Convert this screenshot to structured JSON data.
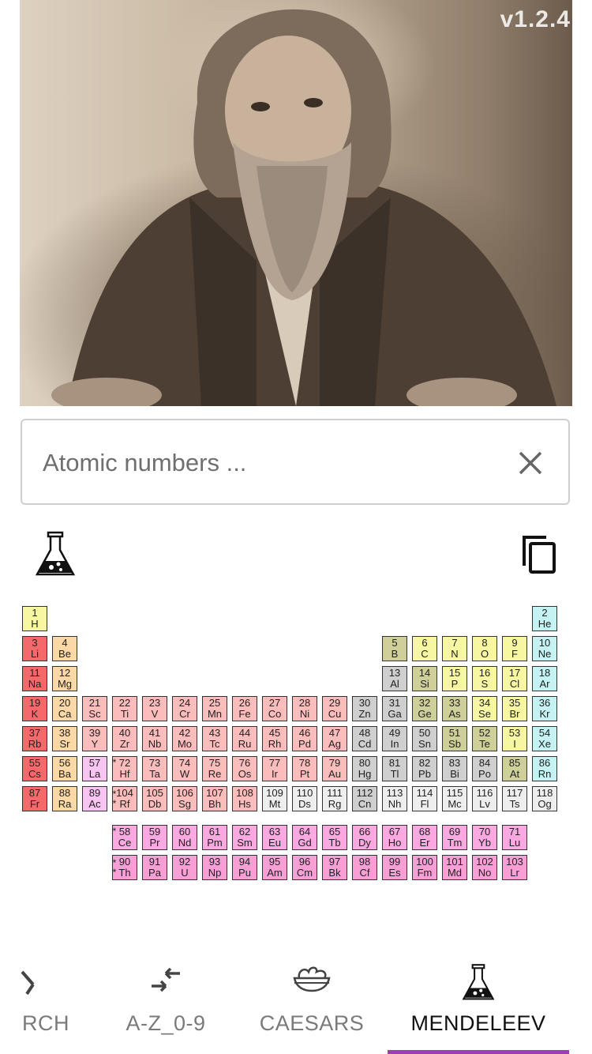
{
  "version": "v1.2.4",
  "search": {
    "placeholder": "Atomic numbers ..."
  },
  "toolbar": {
    "flask_icon": "flask-icon",
    "copy_icon": "copy-icon"
  },
  "colors": {
    "nonmetal": "#f7f7a3",
    "noble": "#c5f3f3",
    "alkali": "#f46a6a",
    "alkaline": "#fbd8a5",
    "metalloid": "#cfcf9a",
    "transition": "#fbbcbc",
    "posttransition": "#cfcfcf",
    "unknown": "#eeeeee",
    "lanthanide": "#fba9e0",
    "actinide": "#f99fd6",
    "scandium": "#f8c4f2",
    "accent": "#9b3fb5"
  },
  "elements": [
    {
      "n": "1",
      "s": "H",
      "r": 0,
      "c": 0,
      "cat": "nonmetal"
    },
    {
      "n": "2",
      "s": "He",
      "r": 0,
      "c": 17,
      "cat": "noble"
    },
    {
      "n": "3",
      "s": "Li",
      "r": 1,
      "c": 0,
      "cat": "alkali"
    },
    {
      "n": "4",
      "s": "Be",
      "r": 1,
      "c": 1,
      "cat": "alkaline"
    },
    {
      "n": "5",
      "s": "B",
      "r": 1,
      "c": 12,
      "cat": "metalloid"
    },
    {
      "n": "6",
      "s": "C",
      "r": 1,
      "c": 13,
      "cat": "nonmetal"
    },
    {
      "n": "7",
      "s": "N",
      "r": 1,
      "c": 14,
      "cat": "nonmetal"
    },
    {
      "n": "8",
      "s": "O",
      "r": 1,
      "c": 15,
      "cat": "nonmetal"
    },
    {
      "n": "9",
      "s": "F",
      "r": 1,
      "c": 16,
      "cat": "nonmetal"
    },
    {
      "n": "10",
      "s": "Ne",
      "r": 1,
      "c": 17,
      "cat": "noble"
    },
    {
      "n": "11",
      "s": "Na",
      "r": 2,
      "c": 0,
      "cat": "alkali"
    },
    {
      "n": "12",
      "s": "Mg",
      "r": 2,
      "c": 1,
      "cat": "alkaline"
    },
    {
      "n": "13",
      "s": "Al",
      "r": 2,
      "c": 12,
      "cat": "posttransition"
    },
    {
      "n": "14",
      "s": "Si",
      "r": 2,
      "c": 13,
      "cat": "metalloid"
    },
    {
      "n": "15",
      "s": "P",
      "r": 2,
      "c": 14,
      "cat": "nonmetal"
    },
    {
      "n": "16",
      "s": "S",
      "r": 2,
      "c": 15,
      "cat": "nonmetal"
    },
    {
      "n": "17",
      "s": "Cl",
      "r": 2,
      "c": 16,
      "cat": "nonmetal"
    },
    {
      "n": "18",
      "s": "Ar",
      "r": 2,
      "c": 17,
      "cat": "noble"
    },
    {
      "n": "19",
      "s": "K",
      "r": 3,
      "c": 0,
      "cat": "alkali"
    },
    {
      "n": "20",
      "s": "Ca",
      "r": 3,
      "c": 1,
      "cat": "alkaline"
    },
    {
      "n": "21",
      "s": "Sc",
      "r": 3,
      "c": 2,
      "cat": "transition"
    },
    {
      "n": "22",
      "s": "Ti",
      "r": 3,
      "c": 3,
      "cat": "transition"
    },
    {
      "n": "23",
      "s": "V",
      "r": 3,
      "c": 4,
      "cat": "transition"
    },
    {
      "n": "24",
      "s": "Cr",
      "r": 3,
      "c": 5,
      "cat": "transition"
    },
    {
      "n": "25",
      "s": "Mn",
      "r": 3,
      "c": 6,
      "cat": "transition"
    },
    {
      "n": "26",
      "s": "Fe",
      "r": 3,
      "c": 7,
      "cat": "transition"
    },
    {
      "n": "27",
      "s": "Co",
      "r": 3,
      "c": 8,
      "cat": "transition"
    },
    {
      "n": "28",
      "s": "Ni",
      "r": 3,
      "c": 9,
      "cat": "transition"
    },
    {
      "n": "29",
      "s": "Cu",
      "r": 3,
      "c": 10,
      "cat": "transition"
    },
    {
      "n": "30",
      "s": "Zn",
      "r": 3,
      "c": 11,
      "cat": "posttransition"
    },
    {
      "n": "31",
      "s": "Ga",
      "r": 3,
      "c": 12,
      "cat": "posttransition"
    },
    {
      "n": "32",
      "s": "Ge",
      "r": 3,
      "c": 13,
      "cat": "metalloid"
    },
    {
      "n": "33",
      "s": "As",
      "r": 3,
      "c": 14,
      "cat": "metalloid"
    },
    {
      "n": "34",
      "s": "Se",
      "r": 3,
      "c": 15,
      "cat": "nonmetal"
    },
    {
      "n": "35",
      "s": "Br",
      "r": 3,
      "c": 16,
      "cat": "nonmetal"
    },
    {
      "n": "36",
      "s": "Kr",
      "r": 3,
      "c": 17,
      "cat": "noble"
    },
    {
      "n": "37",
      "s": "Rb",
      "r": 4,
      "c": 0,
      "cat": "alkali"
    },
    {
      "n": "38",
      "s": "Sr",
      "r": 4,
      "c": 1,
      "cat": "alkaline"
    },
    {
      "n": "39",
      "s": "Y",
      "r": 4,
      "c": 2,
      "cat": "transition"
    },
    {
      "n": "40",
      "s": "Zr",
      "r": 4,
      "c": 3,
      "cat": "transition"
    },
    {
      "n": "41",
      "s": "Nb",
      "r": 4,
      "c": 4,
      "cat": "transition"
    },
    {
      "n": "42",
      "s": "Mo",
      "r": 4,
      "c": 5,
      "cat": "transition"
    },
    {
      "n": "43",
      "s": "Tc",
      "r": 4,
      "c": 6,
      "cat": "transition"
    },
    {
      "n": "44",
      "s": "Ru",
      "r": 4,
      "c": 7,
      "cat": "transition"
    },
    {
      "n": "45",
      "s": "Rh",
      "r": 4,
      "c": 8,
      "cat": "transition"
    },
    {
      "n": "46",
      "s": "Pd",
      "r": 4,
      "c": 9,
      "cat": "transition"
    },
    {
      "n": "47",
      "s": "Ag",
      "r": 4,
      "c": 10,
      "cat": "transition"
    },
    {
      "n": "48",
      "s": "Cd",
      "r": 4,
      "c": 11,
      "cat": "posttransition"
    },
    {
      "n": "49",
      "s": "In",
      "r": 4,
      "c": 12,
      "cat": "posttransition"
    },
    {
      "n": "50",
      "s": "Sn",
      "r": 4,
      "c": 13,
      "cat": "posttransition"
    },
    {
      "n": "51",
      "s": "Sb",
      "r": 4,
      "c": 14,
      "cat": "metalloid"
    },
    {
      "n": "52",
      "s": "Te",
      "r": 4,
      "c": 15,
      "cat": "metalloid"
    },
    {
      "n": "53",
      "s": "I",
      "r": 4,
      "c": 16,
      "cat": "nonmetal"
    },
    {
      "n": "54",
      "s": "Xe",
      "r": 4,
      "c": 17,
      "cat": "noble"
    },
    {
      "n": "55",
      "s": "Cs",
      "r": 5,
      "c": 0,
      "cat": "alkali"
    },
    {
      "n": "56",
      "s": "Ba",
      "r": 5,
      "c": 1,
      "cat": "alkaline"
    },
    {
      "n": "57",
      "s": "La",
      "r": 5,
      "c": 2,
      "cat": "scandium"
    },
    {
      "n": "72",
      "s": "Hf",
      "r": 5,
      "c": 3,
      "cat": "transition"
    },
    {
      "n": "73",
      "s": "Ta",
      "r": 5,
      "c": 4,
      "cat": "transition"
    },
    {
      "n": "74",
      "s": "W",
      "r": 5,
      "c": 5,
      "cat": "transition"
    },
    {
      "n": "75",
      "s": "Re",
      "r": 5,
      "c": 6,
      "cat": "transition"
    },
    {
      "n": "76",
      "s": "Os",
      "r": 5,
      "c": 7,
      "cat": "transition"
    },
    {
      "n": "77",
      "s": "Ir",
      "r": 5,
      "c": 8,
      "cat": "transition"
    },
    {
      "n": "78",
      "s": "Pt",
      "r": 5,
      "c": 9,
      "cat": "transition"
    },
    {
      "n": "79",
      "s": "Au",
      "r": 5,
      "c": 10,
      "cat": "transition"
    },
    {
      "n": "80",
      "s": "Hg",
      "r": 5,
      "c": 11,
      "cat": "posttransition"
    },
    {
      "n": "81",
      "s": "Tl",
      "r": 5,
      "c": 12,
      "cat": "posttransition"
    },
    {
      "n": "82",
      "s": "Pb",
      "r": 5,
      "c": 13,
      "cat": "posttransition"
    },
    {
      "n": "83",
      "s": "Bi",
      "r": 5,
      "c": 14,
      "cat": "posttransition"
    },
    {
      "n": "84",
      "s": "Po",
      "r": 5,
      "c": 15,
      "cat": "posttransition"
    },
    {
      "n": "85",
      "s": "At",
      "r": 5,
      "c": 16,
      "cat": "metalloid"
    },
    {
      "n": "86",
      "s": "Rn",
      "r": 5,
      "c": 17,
      "cat": "noble"
    },
    {
      "n": "87",
      "s": "Fr",
      "r": 6,
      "c": 0,
      "cat": "alkali"
    },
    {
      "n": "88",
      "s": "Ra",
      "r": 6,
      "c": 1,
      "cat": "alkaline"
    },
    {
      "n": "89",
      "s": "Ac",
      "r": 6,
      "c": 2,
      "cat": "scandium"
    },
    {
      "n": "104",
      "s": "Rf",
      "r": 6,
      "c": 3,
      "cat": "transition"
    },
    {
      "n": "105",
      "s": "Db",
      "r": 6,
      "c": 4,
      "cat": "transition"
    },
    {
      "n": "106",
      "s": "Sg",
      "r": 6,
      "c": 5,
      "cat": "transition"
    },
    {
      "n": "107",
      "s": "Bh",
      "r": 6,
      "c": 6,
      "cat": "transition"
    },
    {
      "n": "108",
      "s": "Hs",
      "r": 6,
      "c": 7,
      "cat": "transition"
    },
    {
      "n": "109",
      "s": "Mt",
      "r": 6,
      "c": 8,
      "cat": "unknown"
    },
    {
      "n": "110",
      "s": "Ds",
      "r": 6,
      "c": 9,
      "cat": "unknown"
    },
    {
      "n": "111",
      "s": "Rg",
      "r": 6,
      "c": 10,
      "cat": "unknown"
    },
    {
      "n": "112",
      "s": "Cn",
      "r": 6,
      "c": 11,
      "cat": "posttransition"
    },
    {
      "n": "113",
      "s": "Nh",
      "r": 6,
      "c": 12,
      "cat": "unknown"
    },
    {
      "n": "114",
      "s": "Fl",
      "r": 6,
      "c": 13,
      "cat": "unknown"
    },
    {
      "n": "115",
      "s": "Mc",
      "r": 6,
      "c": 14,
      "cat": "unknown"
    },
    {
      "n": "116",
      "s": "Lv",
      "r": 6,
      "c": 15,
      "cat": "unknown"
    },
    {
      "n": "117",
      "s": "Ts",
      "r": 6,
      "c": 16,
      "cat": "unknown"
    },
    {
      "n": "118",
      "s": "Og",
      "r": 6,
      "c": 17,
      "cat": "unknown"
    },
    {
      "n": "58",
      "s": "Ce",
      "r": 7,
      "c": 3,
      "cat": "lanthanide"
    },
    {
      "n": "59",
      "s": "Pr",
      "r": 7,
      "c": 4,
      "cat": "lanthanide"
    },
    {
      "n": "60",
      "s": "Nd",
      "r": 7,
      "c": 5,
      "cat": "lanthanide"
    },
    {
      "n": "61",
      "s": "Pm",
      "r": 7,
      "c": 6,
      "cat": "lanthanide"
    },
    {
      "n": "62",
      "s": "Sm",
      "r": 7,
      "c": 7,
      "cat": "lanthanide"
    },
    {
      "n": "63",
      "s": "Eu",
      "r": 7,
      "c": 8,
      "cat": "lanthanide"
    },
    {
      "n": "64",
      "s": "Gd",
      "r": 7,
      "c": 9,
      "cat": "lanthanide"
    },
    {
      "n": "65",
      "s": "Tb",
      "r": 7,
      "c": 10,
      "cat": "lanthanide"
    },
    {
      "n": "66",
      "s": "Dy",
      "r": 7,
      "c": 11,
      "cat": "lanthanide"
    },
    {
      "n": "67",
      "s": "Ho",
      "r": 7,
      "c": 12,
      "cat": "lanthanide"
    },
    {
      "n": "68",
      "s": "Er",
      "r": 7,
      "c": 13,
      "cat": "lanthanide"
    },
    {
      "n": "69",
      "s": "Tm",
      "r": 7,
      "c": 14,
      "cat": "lanthanide"
    },
    {
      "n": "70",
      "s": "Yb",
      "r": 7,
      "c": 15,
      "cat": "lanthanide"
    },
    {
      "n": "71",
      "s": "Lu",
      "r": 7,
      "c": 16,
      "cat": "lanthanide"
    },
    {
      "n": "90",
      "s": "Th",
      "r": 8,
      "c": 3,
      "cat": "actinide"
    },
    {
      "n": "91",
      "s": "Pa",
      "r": 8,
      "c": 4,
      "cat": "actinide"
    },
    {
      "n": "92",
      "s": "U",
      "r": 8,
      "c": 5,
      "cat": "actinide"
    },
    {
      "n": "93",
      "s": "Np",
      "r": 8,
      "c": 6,
      "cat": "actinide"
    },
    {
      "n": "94",
      "s": "Pu",
      "r": 8,
      "c": 7,
      "cat": "actinide"
    },
    {
      "n": "95",
      "s": "Am",
      "r": 8,
      "c": 8,
      "cat": "actinide"
    },
    {
      "n": "96",
      "s": "Cm",
      "r": 8,
      "c": 9,
      "cat": "actinide"
    },
    {
      "n": "97",
      "s": "Bk",
      "r": 8,
      "c": 10,
      "cat": "actinide"
    },
    {
      "n": "98",
      "s": "Cf",
      "r": 8,
      "c": 11,
      "cat": "actinide"
    },
    {
      "n": "99",
      "s": "Es",
      "r": 8,
      "c": 12,
      "cat": "actinide"
    },
    {
      "n": "100",
      "s": "Fm",
      "r": 8,
      "c": 13,
      "cat": "actinide"
    },
    {
      "n": "101",
      "s": "Md",
      "r": 8,
      "c": 14,
      "cat": "actinide"
    },
    {
      "n": "102",
      "s": "No",
      "r": 8,
      "c": 15,
      "cat": "actinide"
    },
    {
      "n": "103",
      "s": "Lr",
      "r": 8,
      "c": 16,
      "cat": "actinide"
    }
  ],
  "stars": [
    {
      "r": 5,
      "t": "*"
    },
    {
      "r": 6,
      "t": "*\n*"
    },
    {
      "r": 7,
      "t": "*"
    },
    {
      "r": 8,
      "t": "*\n*"
    }
  ],
  "tabs": [
    {
      "label": "RCH",
      "icon": "magnifier-icon",
      "active": false
    },
    {
      "label": "A-Z_0-9",
      "icon": "swap-arrows-icon",
      "active": false
    },
    {
      "label": "CAESARS",
      "icon": "salad-bowl-icon",
      "active": false
    },
    {
      "label": "MENDELEEV",
      "icon": "flask-icon",
      "active": true
    }
  ]
}
